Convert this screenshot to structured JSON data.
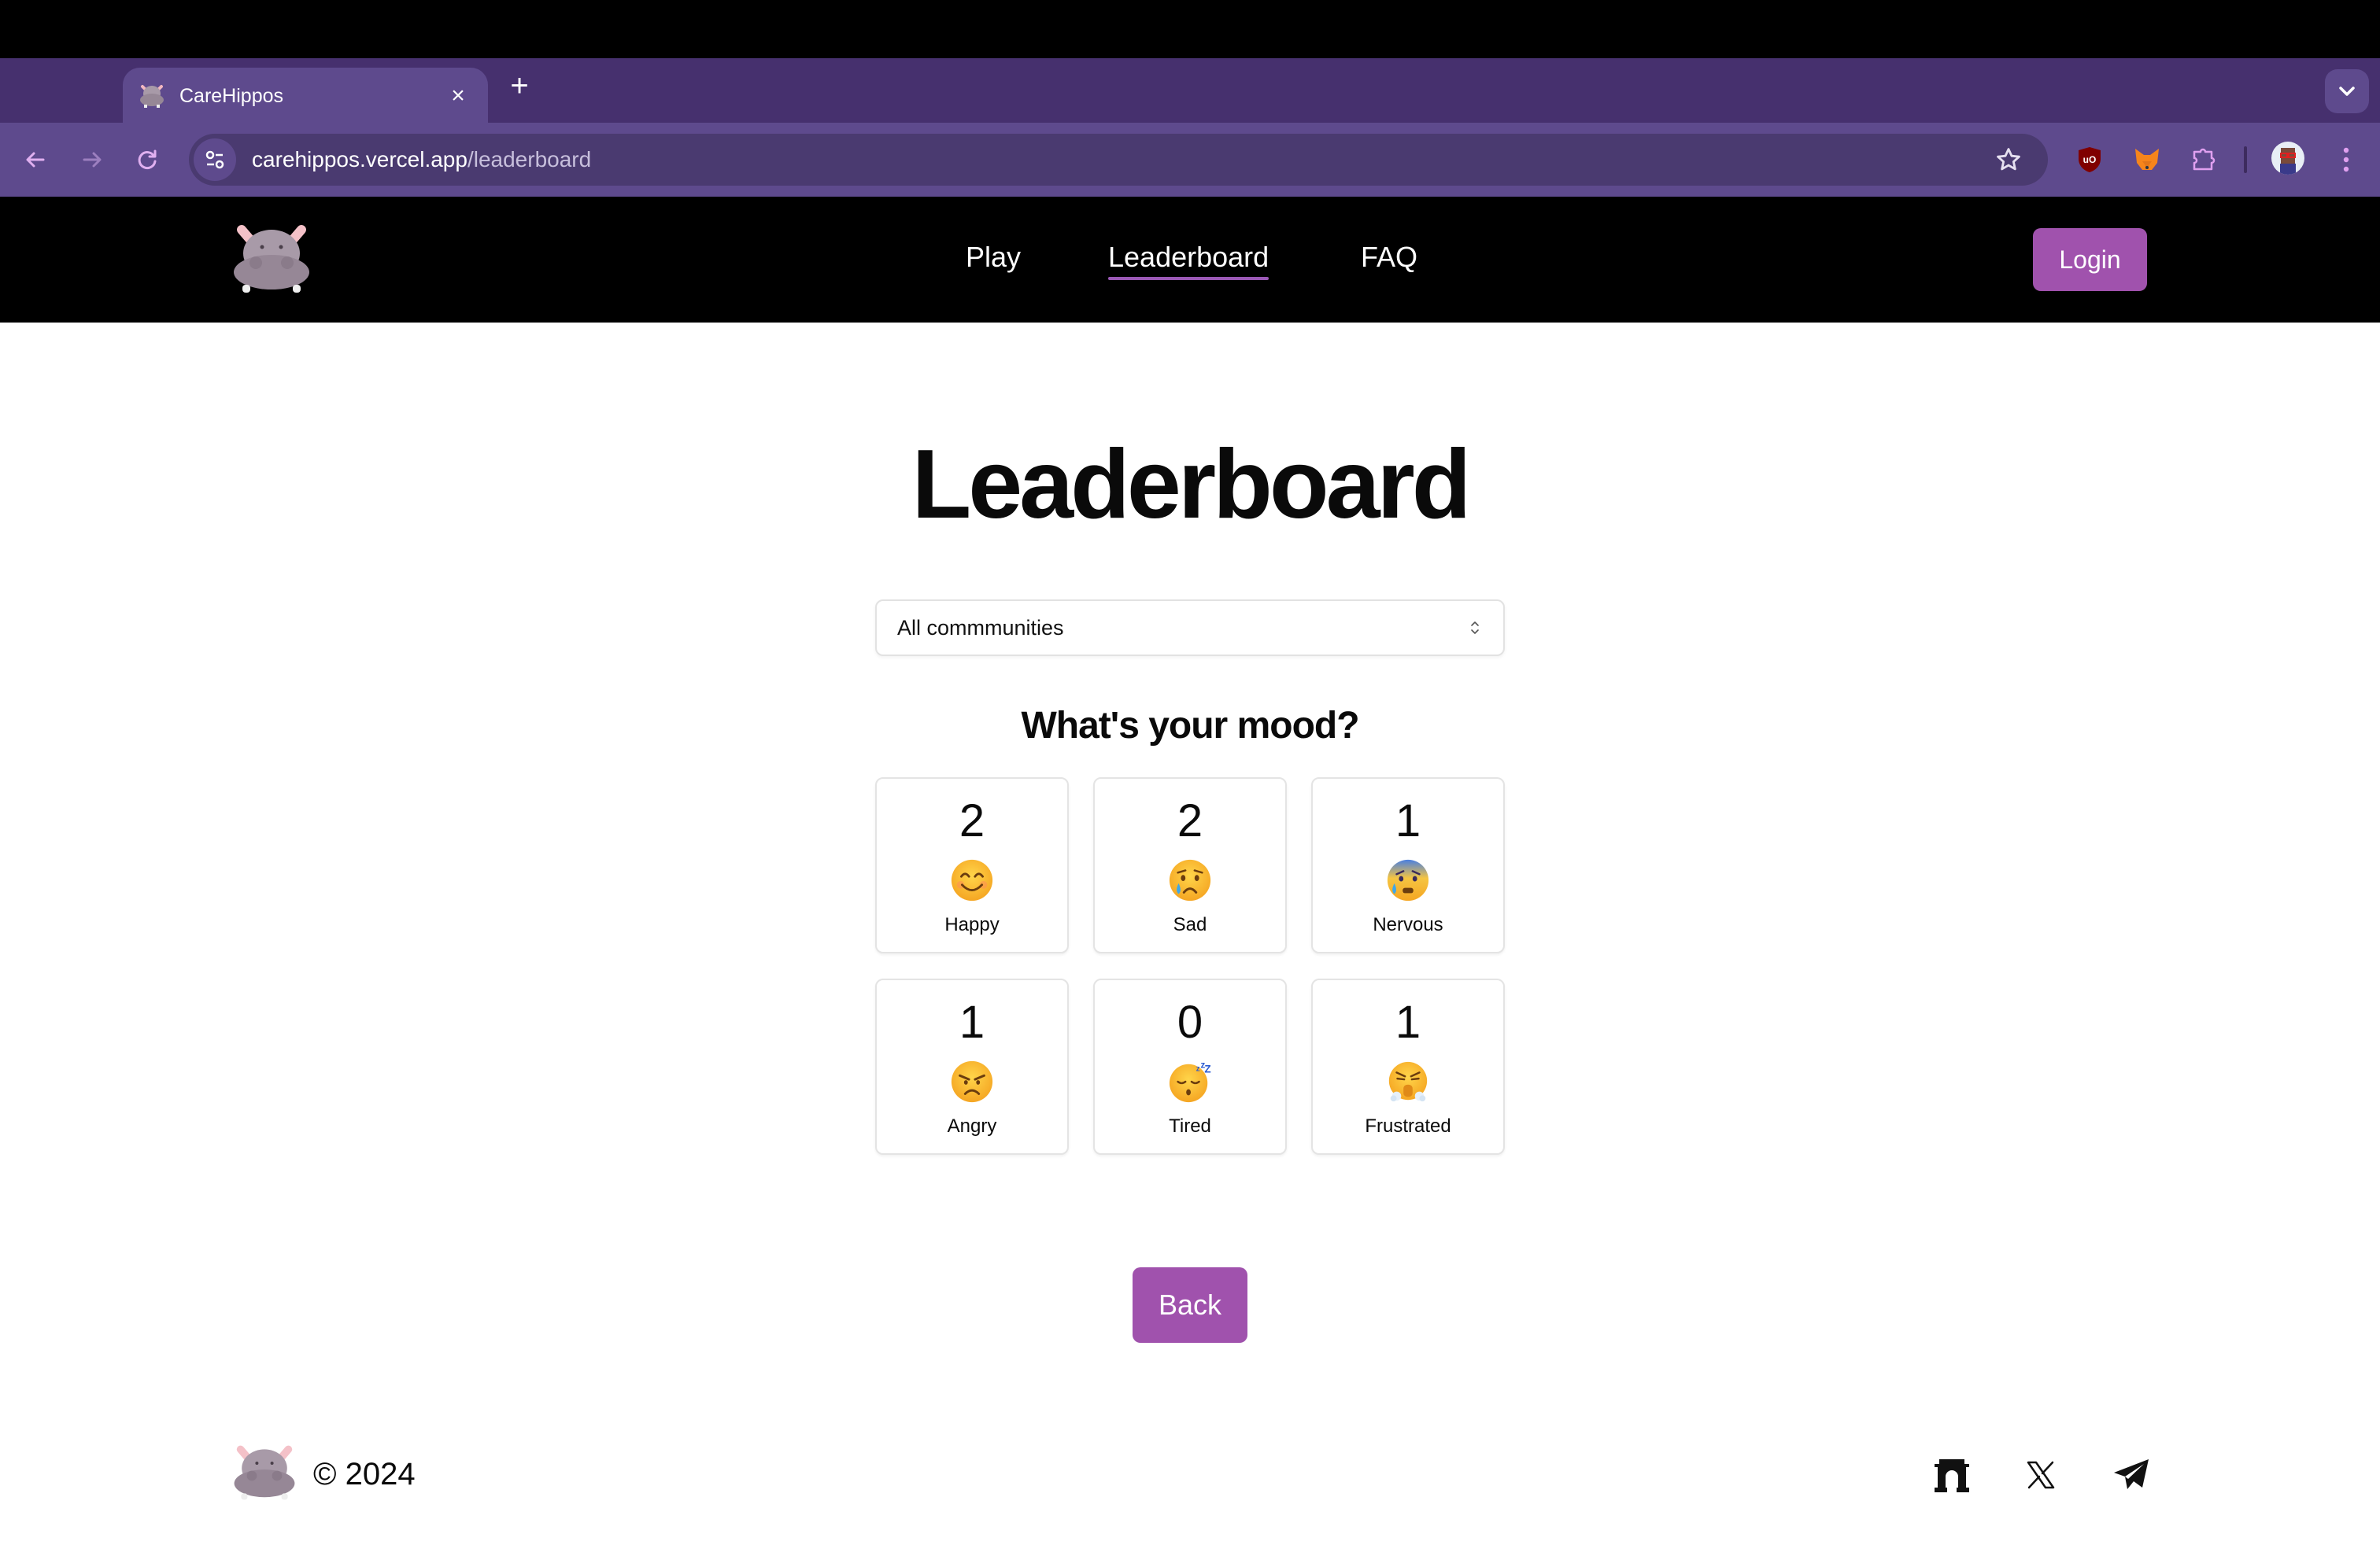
{
  "browser": {
    "tab_title": "CareHippos",
    "tab_close": "×",
    "new_tab": "+",
    "url_domain": "carehippos.vercel.app",
    "url_path": "/leaderboard",
    "extensions": [
      "ublock-origin",
      "metamask",
      "extensions-puzzle"
    ]
  },
  "header": {
    "nav": [
      {
        "label": "Play",
        "active": false
      },
      {
        "label": "Leaderboard",
        "active": true
      },
      {
        "label": "FAQ",
        "active": false
      }
    ],
    "login_label": "Login",
    "accent_color": "#a052ad"
  },
  "main": {
    "title": "Leaderboard",
    "community_select": {
      "selected": "All commmunities"
    },
    "mood_heading": "What's your mood?",
    "moods": [
      {
        "label": "Happy",
        "count": "2",
        "icon": "smiling-face-icon"
      },
      {
        "label": "Sad",
        "count": "2",
        "icon": "crying-face-icon"
      },
      {
        "label": "Nervous",
        "count": "1",
        "icon": "anxious-sweat-face-icon"
      },
      {
        "label": "Angry",
        "count": "1",
        "icon": "angry-face-icon"
      },
      {
        "label": "Tired",
        "count": "0",
        "icon": "sleeping-face-icon"
      },
      {
        "label": "Frustrated",
        "count": "1",
        "icon": "steam-nose-face-icon"
      }
    ],
    "back_label": "Back"
  },
  "footer": {
    "copyright": "© 2024",
    "social": [
      "arch-icon",
      "x-icon",
      "telegram-icon"
    ]
  }
}
